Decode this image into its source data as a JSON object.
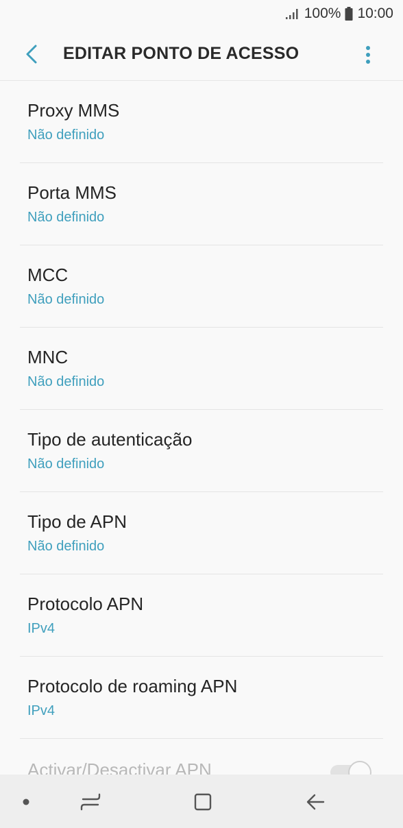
{
  "status_bar": {
    "battery_percent": "100%",
    "time": "10:00",
    "signal_icon": "signal-icon",
    "battery_icon": "battery-icon"
  },
  "app_bar": {
    "back_icon": "back-arrow-icon",
    "title": "EDITAR PONTO DE ACESSO",
    "more_icon": "more-vert-icon"
  },
  "settings": [
    {
      "title": "Proxy MMS",
      "value": "Não definido"
    },
    {
      "title": "Porta MMS",
      "value": "Não definido"
    },
    {
      "title": "MCC",
      "value": "Não definido"
    },
    {
      "title": "MNC",
      "value": "Não definido"
    },
    {
      "title": "Tipo de autenticação",
      "value": "Não definido"
    },
    {
      "title": "Tipo de APN",
      "value": "Não definido"
    },
    {
      "title": "Protocolo APN",
      "value": "IPv4"
    },
    {
      "title": "Protocolo de roaming APN",
      "value": "IPv4"
    }
  ],
  "toggle_row": {
    "title": "Activar/Desactivar APN",
    "enabled": false
  },
  "nav_bar": {
    "dot_icon": "dot-icon",
    "recents_icon": "recents-icon",
    "home_icon": "home-icon",
    "back_icon": "nav-back-icon"
  },
  "colors": {
    "accent": "#3f9fbd",
    "background": "#f9f9f9",
    "nav_background": "#eeeeee"
  }
}
